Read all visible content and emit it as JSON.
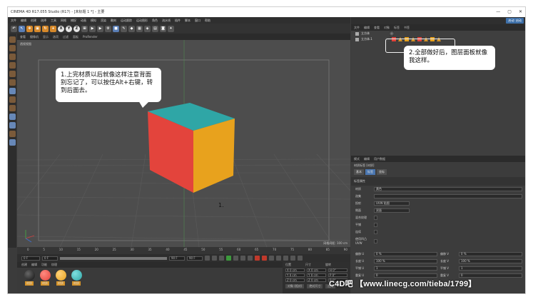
{
  "window": {
    "title": "CINEMA 4D R17.055 Studio (R17) - [未标题 1 *] - 主要",
    "controls": [
      "—",
      "▢",
      "✕"
    ]
  },
  "menu": {
    "items": [
      "文件",
      "编辑",
      "创建",
      "选择",
      "工具",
      "网格",
      "捕捉",
      "动画",
      "模拟",
      "渲染",
      "雕刻",
      "运动跟踪",
      "运动图形",
      "角色",
      "流水线",
      "插件",
      "脚本",
      "窗口",
      "帮助"
    ]
  },
  "toolbar": {
    "buttons": [
      "undo",
      "select",
      "move",
      "scale",
      "rotate",
      "add",
      "X",
      "Y",
      "Z",
      "coord",
      "render-view",
      "render",
      "render-settings",
      "cube",
      "pen",
      "subdivision",
      "array",
      "deformer",
      "scene",
      "camera",
      "light"
    ]
  },
  "viewport": {
    "menus": [
      "查看",
      "摄像机",
      "显示",
      "选项",
      "过滤",
      "面板",
      "ProRender"
    ],
    "label": "透视视图",
    "status": "网格间距: 100 cm",
    "cube_colors": {
      "top": "#2fa6a6",
      "left": "#e3443c",
      "right": "#e8a21d"
    },
    "marker": "1."
  },
  "callouts": {
    "first": "1.上完材质以后就像这样注意背面别忘记了，可以按住Alt+右键，转到后面去。",
    "second": "2.全部做好后，图层面板就像我这样。"
  },
  "right_panel": {
    "layout_button": "启动: 启动",
    "object_manager_menus": [
      "文件",
      "编辑",
      "查看",
      "对象",
      "标签",
      "书签"
    ],
    "objects": [
      {
        "name": "立方体"
      },
      {
        "name": "立方体.1"
      }
    ],
    "attr_menus": [
      "模式",
      "编辑",
      "用户数据"
    ],
    "attr_subtitle": "材质标签 [材质]",
    "attr_tabs": [
      "基本",
      "标签",
      "坐标"
    ],
    "attr_section": "标签属性",
    "attr_rows": [
      {
        "label": "材质",
        "value": "黄色"
      },
      {
        "label": "选集",
        "value": ""
      },
      {
        "label": "投射",
        "value": "UVW 贴图"
      },
      {
        "label": "侧面",
        "value": "双面"
      },
      {
        "label": "混合纹理",
        "value": ""
      },
      {
        "label": "平铺",
        "value": ""
      },
      {
        "label": "连续",
        "value": ""
      },
      {
        "label": "使用凹凸 UVW",
        "value": ""
      }
    ],
    "attr_offsets": [
      {
        "label": "偏移 U",
        "value": "0 %",
        "label2": "偏移 V",
        "value2": "0 %"
      },
      {
        "label": "长度 U",
        "value": "100 %",
        "label2": "长度 V",
        "value2": "100 %"
      },
      {
        "label": "平铺 U",
        "value": "1",
        "label2": "平铺 V",
        "value2": "1"
      },
      {
        "label": "重复 U",
        "value": "0",
        "label2": "重复 V",
        "value2": "0"
      }
    ]
  },
  "timeline": {
    "ticks": [
      "0",
      "5",
      "10",
      "15",
      "20",
      "25",
      "30",
      "35",
      "40",
      "45",
      "50",
      "55",
      "60",
      "65",
      "70",
      "75",
      "80",
      "85",
      "90"
    ],
    "frame_start": "0 F",
    "frame_current": "0 F",
    "frame_end": "90 F",
    "frame_end2": "90 F"
  },
  "materials": {
    "menus": [
      "创建",
      "编辑",
      "功能",
      "纹理"
    ],
    "items": [
      {
        "name": "材质",
        "color": "#1f1f1f"
      },
      {
        "name": "材质",
        "color": "#e3443c"
      },
      {
        "name": "材质",
        "color": "#e8a21d"
      },
      {
        "name": "材质",
        "color": "#2fa6a6"
      }
    ]
  },
  "coords": {
    "headers": [
      "位置",
      "尺寸",
      "旋转"
    ],
    "rows": [
      [
        "X 0 cm",
        "X 0 cm",
        "H 0°"
      ],
      [
        "Y 0 cm",
        "Y 0 cm",
        "P 0°"
      ],
      [
        "Z 0 cm",
        "Z 0 cm",
        "B 0°"
      ]
    ],
    "mode": "对象 (相对)",
    "size_mode": "绝对尺寸",
    "apply": "应用"
  },
  "watermark": "C4D吧 【www.linecg.com/tieba/1799】"
}
